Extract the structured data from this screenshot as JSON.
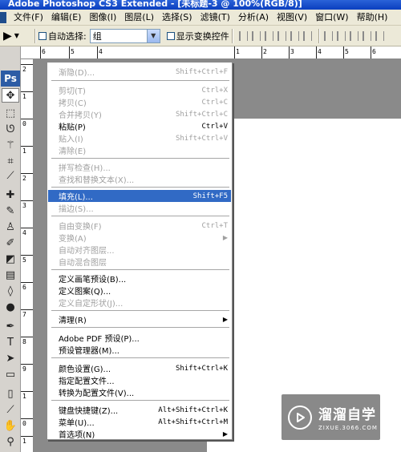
{
  "window": {
    "title": "Adobe Photoshop CS3 Extended - [未标题-3 @ 100%(RGB/8)]"
  },
  "menubar": [
    "文件(F)",
    "编辑(E)",
    "图像(I)",
    "图层(L)",
    "选择(S)",
    "滤镜(T)",
    "分析(A)",
    "视图(V)",
    "窗口(W)",
    "帮助(H)"
  ],
  "options": {
    "auto_select_label": "自动选择:",
    "auto_select_value": "组",
    "show_transform_label": "显示变换控件"
  },
  "toolbox": {
    "logo": "Ps"
  },
  "ruler": {
    "top": [
      "6",
      "5",
      "4",
      "1",
      "2",
      "3",
      "4",
      "5",
      "6"
    ],
    "left": [
      "2",
      "1",
      "0",
      "1",
      "2",
      "3",
      "4",
      "5",
      "6",
      "7",
      "8",
      "9",
      "1",
      "0",
      "1"
    ]
  },
  "edit_menu": [
    {
      "label": "渐隐(D)...",
      "shortcut": "Shift+Ctrl+F"
    },
    {
      "label": "剪切(T)",
      "shortcut": "Ctrl+X"
    },
    {
      "label": "拷贝(C)",
      "shortcut": "Ctrl+C"
    },
    {
      "label": "合并拷贝(Y)",
      "shortcut": "Shift+Ctrl+C"
    },
    {
      "label": "粘贴(P)",
      "shortcut": "Ctrl+V"
    },
    {
      "label": "贴入(I)",
      "shortcut": "Shift+Ctrl+V"
    },
    {
      "label": "清除(E)"
    },
    {
      "label": "拼写检查(H)..."
    },
    {
      "label": "查找和替换文本(X)..."
    },
    {
      "label": "填充(L)...",
      "shortcut": "Shift+F5"
    },
    {
      "label": "描边(S)..."
    },
    {
      "label": "自由变换(F)",
      "shortcut": "Ctrl+T"
    },
    {
      "label": "变换(A)"
    },
    {
      "label": "自动对齐图层..."
    },
    {
      "label": "自动混合图层"
    },
    {
      "label": "定义画笔预设(B)..."
    },
    {
      "label": "定义图案(Q)..."
    },
    {
      "label": "定义自定形状(J)..."
    },
    {
      "label": "清理(R)"
    },
    {
      "label": "Adobe PDF 预设(P)..."
    },
    {
      "label": "预设管理器(M)..."
    },
    {
      "label": "颜色设置(G)...",
      "shortcut": "Shift+Ctrl+K"
    },
    {
      "label": "指定配置文件..."
    },
    {
      "label": "转换为配置文件(V)..."
    },
    {
      "label": "键盘快捷键(Z)...",
      "shortcut": "Alt+Shift+Ctrl+K"
    },
    {
      "label": "菜单(U)...",
      "shortcut": "Alt+Shift+Ctrl+M"
    },
    {
      "label": "首选项(N)"
    }
  ],
  "watermark": {
    "brand": "溜溜自学",
    "url": "ZIXUE.3066.COM"
  }
}
